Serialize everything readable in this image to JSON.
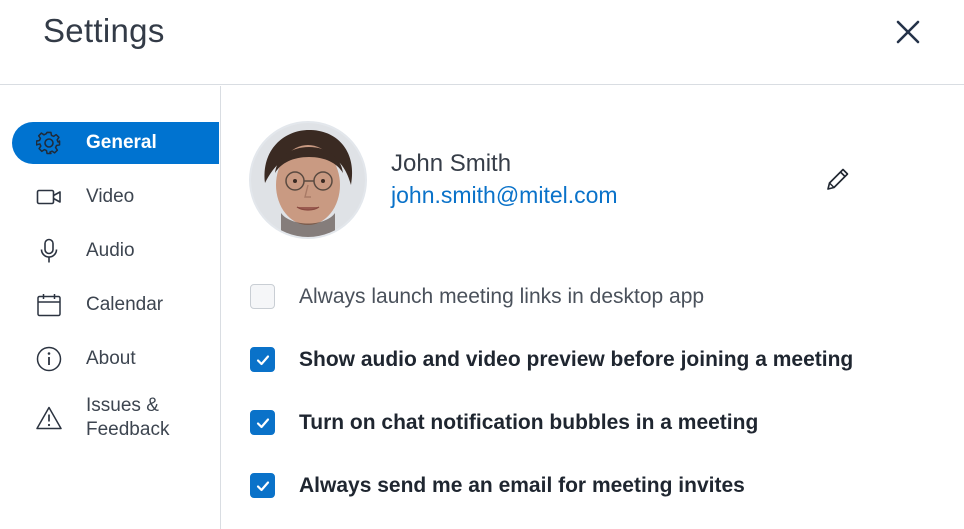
{
  "header": {
    "title": "Settings"
  },
  "sidebar": {
    "items": [
      {
        "label": "General",
        "icon": "gear-icon",
        "active": true
      },
      {
        "label": "Video",
        "icon": "video-camera-icon",
        "active": false
      },
      {
        "label": "Audio",
        "icon": "microphone-icon",
        "active": false
      },
      {
        "label": "Calendar",
        "icon": "calendar-icon",
        "active": false
      },
      {
        "label": "About",
        "icon": "info-icon",
        "active": false
      },
      {
        "label": "Issues & Feedback",
        "line1": "Issues &",
        "line2": "Feedback",
        "icon": "warning-icon",
        "active": false
      }
    ]
  },
  "profile": {
    "name": "John Smith",
    "email": "john.smith@mitel.com"
  },
  "options": [
    {
      "label": "Always launch meeting links in desktop app",
      "checked": false
    },
    {
      "label": "Show audio and video preview before joining a meeting",
      "checked": true
    },
    {
      "label": "Turn on chat notification bubbles in a meeting",
      "checked": true
    },
    {
      "label": "Always send me an email for meeting invites",
      "checked": true
    }
  ],
  "colors": {
    "accent": "#0073d0",
    "checkbox_on": "#0a72c9",
    "link": "#0a72c9",
    "divider": "#d9dde2"
  }
}
